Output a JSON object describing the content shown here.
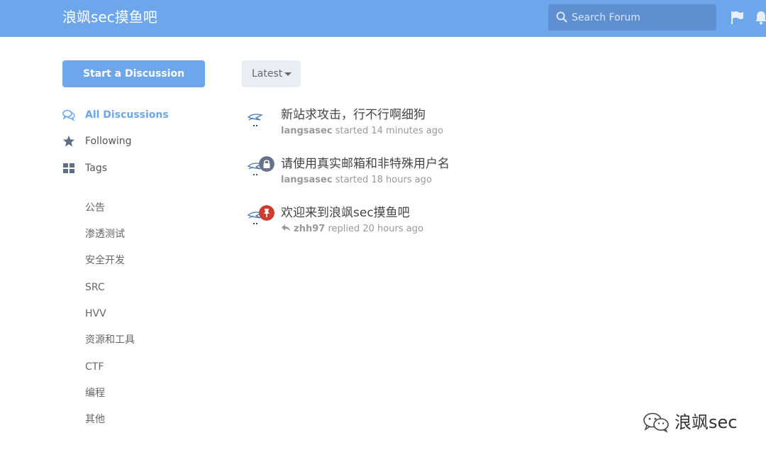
{
  "header": {
    "brand": "浪飒sec摸鱼吧",
    "search_placeholder": "Search Forum",
    "icons": [
      "search-icon",
      "flag-icon",
      "bell-icon"
    ]
  },
  "sidebar": {
    "start_button": "Start a Discussion",
    "nav": [
      {
        "label": "All Discussions",
        "icon": "comments-icon",
        "active": true
      },
      {
        "label": "Following",
        "icon": "star-icon",
        "active": false
      },
      {
        "label": "Tags",
        "icon": "tags-grid-icon",
        "active": false
      }
    ],
    "tags": [
      "公告",
      "渗透测试",
      "安全开发",
      "SRC",
      "HVV",
      "资源和工具",
      "CTF",
      "编程",
      "其他"
    ]
  },
  "main": {
    "sort_label": "Latest",
    "discussions": [
      {
        "title": "新站求攻击，行不行啊细狗",
        "user": "langsasec",
        "action": "started 14 minutes ago",
        "badge": "none"
      },
      {
        "title": "请使用真实邮箱和非特殊用户名",
        "user": "langsasec",
        "action": "started 18 hours ago",
        "badge": "lock-icon"
      },
      {
        "title": "欢迎来到浪飒sec摸鱼吧",
        "user": "zhh97",
        "action": "replied 20 hours ago",
        "badge": "pin-icon",
        "reply": true
      }
    ]
  },
  "watermark": {
    "text": "浪飒sec"
  },
  "colors": {
    "accent": "#6ea6ec",
    "lock_badge": "#66738a",
    "pin_badge": "#d03b2f"
  }
}
